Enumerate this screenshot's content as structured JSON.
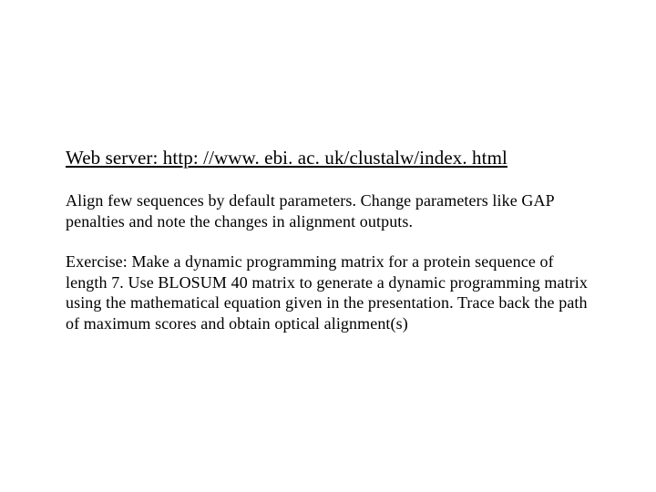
{
  "slide": {
    "heading": "Web server: http: //www. ebi. ac. uk/clustalw/index. html",
    "para1": "Align few sequences by default parameters. Change parameters like GAP penalties and note the changes in alignment outputs.",
    "para2": "Exercise: Make a dynamic programming matrix for a protein sequence of length 7. Use BLOSUM 40 matrix to generate a dynamic programming matrix using the mathematical equation given in the presentation. Trace back the path of maximum scores and obtain optical alignment(s)"
  }
}
